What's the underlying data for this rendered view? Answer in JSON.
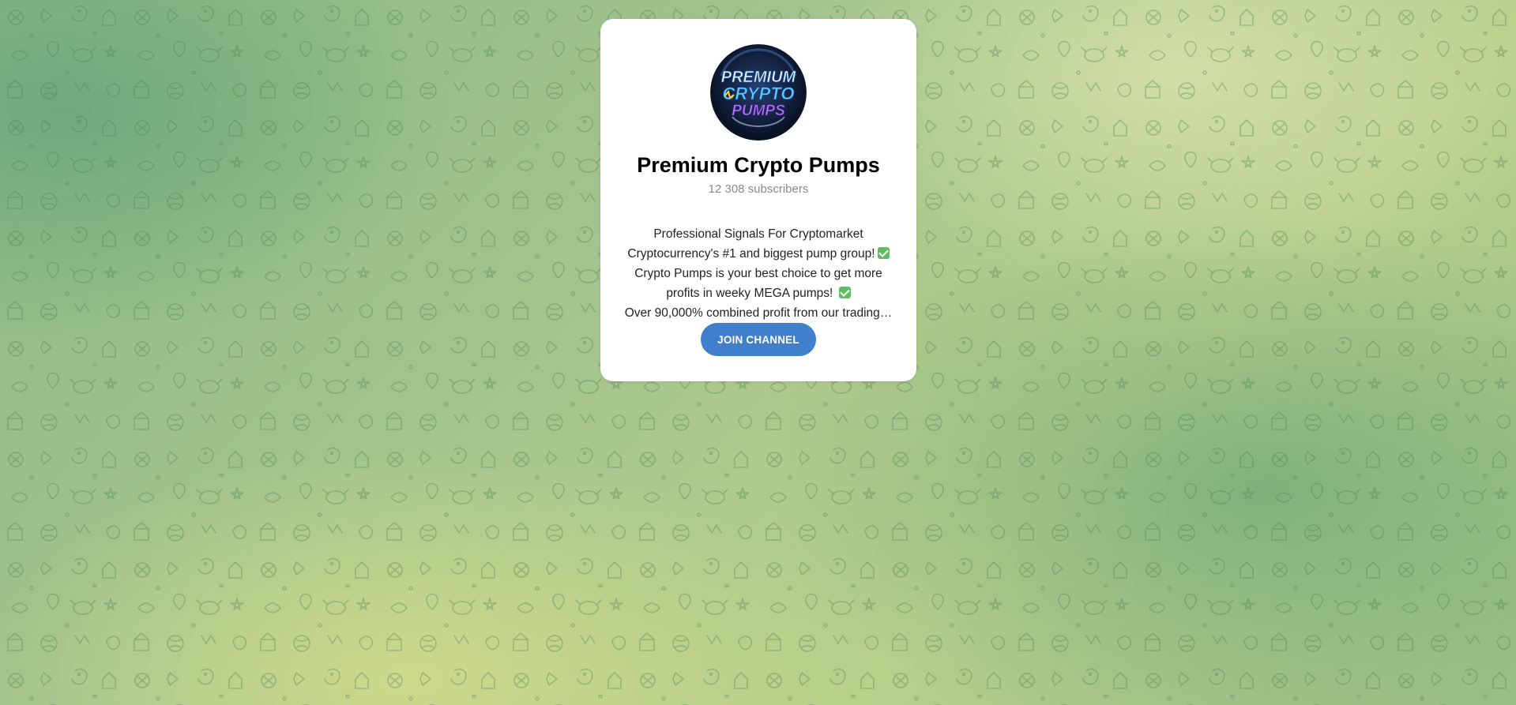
{
  "channel": {
    "name": "Premium Crypto Pumps",
    "subscribers": "12 308 subscribers",
    "avatar": {
      "logo_lines": [
        "PREMIUM",
        "CRYPTO",
        "PUMPS"
      ],
      "colors": {
        "bg": "#0d1a33",
        "ring": "#1e3a6a",
        "premium": "#e8f4ff",
        "crypto": "#5ad0ff",
        "pumps": "#b478ff"
      }
    },
    "description": [
      {
        "text": "Professional Signals For Cryptomarket",
        "icon": ""
      },
      {
        "text": "Cryptocurrency's #1 and biggest pump group!",
        "icon": "check-mark-icon"
      },
      {
        "text": "Crypto Pumps is your best choice to get more",
        "icon": ""
      },
      {
        "text": "profits in weeky MEGA pumps! ",
        "icon": "check-mark-icon"
      },
      {
        "text": "Over 90,000% combined profit from our trading…",
        "icon": ""
      }
    ]
  },
  "actions": {
    "join_label": "JOIN CHANNEL"
  },
  "colors": {
    "join_button": "#3f7fcb",
    "check_icon": "#5fbf5f",
    "background_green": "#8fb889",
    "background_yellow": "#c9d68c"
  }
}
